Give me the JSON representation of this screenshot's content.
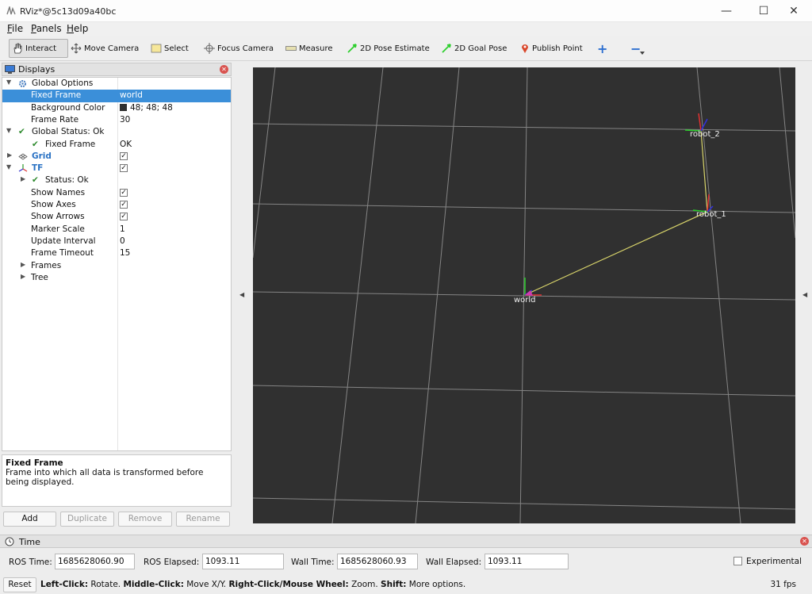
{
  "window": {
    "title": "RViz*@5c13d09a40bc",
    "minimize_glyph": "—",
    "maximize_glyph": "☐",
    "close_glyph": "✕"
  },
  "menu": [
    "File",
    "Panels",
    "Help"
  ],
  "toolbar": {
    "interact": "Interact",
    "move_camera": "Move Camera",
    "select": "Select",
    "focus_camera": "Focus Camera",
    "measure": "Measure",
    "pose_estimate": "2D Pose Estimate",
    "goal_pose": "2D Goal Pose",
    "publish_point": "Publish Point",
    "plus": "+",
    "minus": "−"
  },
  "displays": {
    "title": "Displays",
    "close_glyph": "✕",
    "rows": [
      {
        "label": "Global Options",
        "value": ""
      },
      {
        "label": "Fixed Frame",
        "value": "world"
      },
      {
        "label": "Background Color",
        "value": "48; 48; 48"
      },
      {
        "label": "Frame Rate",
        "value": "30"
      },
      {
        "label": "Global Status: Ok",
        "value": ""
      },
      {
        "label": "Fixed Frame",
        "value": "OK"
      },
      {
        "label": "Grid",
        "value": ""
      },
      {
        "label": "TF",
        "value": ""
      },
      {
        "label": "Status: Ok",
        "value": ""
      },
      {
        "label": "Show Names",
        "value": ""
      },
      {
        "label": "Show Axes",
        "value": ""
      },
      {
        "label": "Show Arrows",
        "value": ""
      },
      {
        "label": "Marker Scale",
        "value": "1"
      },
      {
        "label": "Update Interval",
        "value": "0"
      },
      {
        "label": "Frame Timeout",
        "value": "15"
      },
      {
        "label": "Frames",
        "value": ""
      },
      {
        "label": "Tree",
        "value": ""
      }
    ],
    "check_glyph": "✓",
    "status_tick": "✔",
    "description": {
      "title": "Fixed Frame",
      "text": "Frame into which all data is transformed before being displayed."
    },
    "buttons": {
      "add": "Add",
      "duplicate": "Duplicate",
      "remove": "Remove",
      "rename": "Rename"
    }
  },
  "view": {
    "frames": [
      "world",
      "robot_1",
      "robot_2"
    ],
    "background": "#303030"
  },
  "time": {
    "title": "Time",
    "close_glyph": "✕",
    "ros_time_label": "ROS Time:",
    "ros_time": "1685628060.90",
    "ros_elapsed_label": "ROS Elapsed:",
    "ros_elapsed": "1093.11",
    "wall_time_label": "Wall Time:",
    "wall_time": "1685628060.93",
    "wall_elapsed_label": "Wall Elapsed:",
    "wall_elapsed": "1093.11",
    "experimental": "Experimental"
  },
  "status": {
    "reset": "Reset",
    "h1": "Left-Click:",
    "t1": " Rotate. ",
    "h2": "Middle-Click:",
    "t2": " Move X/Y. ",
    "h3": "Right-Click/Mouse Wheel:",
    "t3": " Zoom. ",
    "h4": "Shift:",
    "t4": " More options.",
    "fps": "31 fps"
  }
}
